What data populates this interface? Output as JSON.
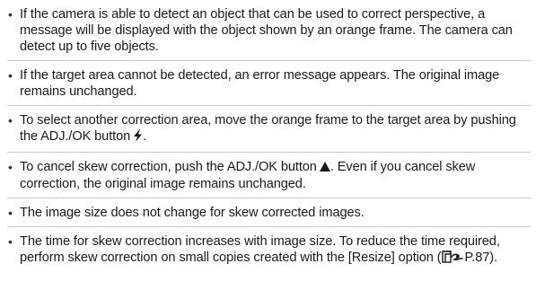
{
  "bullets": [
    {
      "text": "If the camera is able to detect an object that can be used to correct perspective, a message will be displayed with the object shown by an orange frame. The camera can detect up to five objects."
    },
    {
      "text": "If the target area cannot be detected, an error message appears. The original image remains unchanged."
    },
    {
      "text_before": "To select another correction area, move the orange frame to the target area by pushing the ADJ./OK button",
      "icon": "flash-icon",
      "text_after": "."
    },
    {
      "text_before": "To cancel skew correction, push the ADJ./OK button",
      "icon": "up-triangle-icon",
      "text_after": ". Even if you cancel skew correction, the original image remains unchanged."
    },
    {
      "text": "The image size does not change for skew corrected images."
    },
    {
      "text_before": "The time for skew correction increases with image size. To reduce the time required, perform skew correction on small copies created with the [Resize] option (",
      "icon": "page-reference-icon",
      "text_after": "P.87)."
    }
  ],
  "bullet_symbol": "•",
  "colors": {
    "text": "#1a1a1a",
    "divider": "#c9c9c9"
  }
}
